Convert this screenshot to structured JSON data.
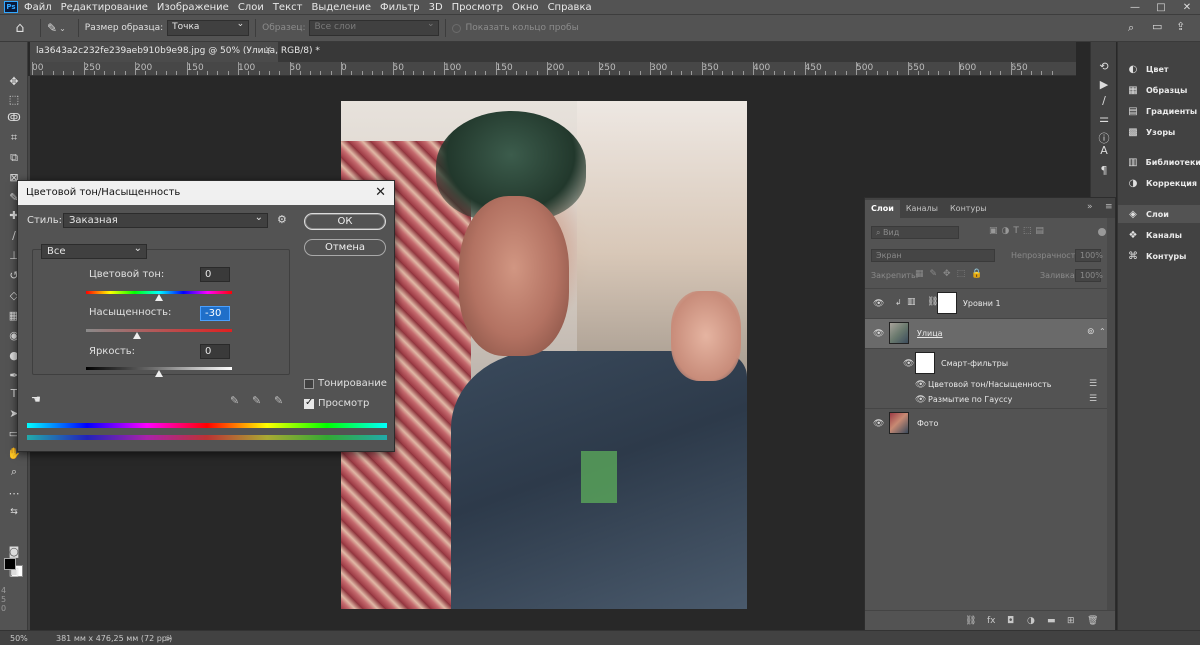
{
  "menu": [
    "Файл",
    "Редактирование",
    "Изображение",
    "Слои",
    "Текст",
    "Выделение",
    "Фильтр",
    "3D",
    "Просмотр",
    "Окно",
    "Справка"
  ],
  "app_logo": "Ps",
  "window_controls": [
    "—",
    "□",
    "✕"
  ],
  "options_bar": {
    "sample_size_label": "Размер образца:",
    "sample_size_value": "Точка",
    "sample_label": "Образец:",
    "sample_value": "Все слои",
    "show_ring_label": "Показать кольцо пробы"
  },
  "document_tab": {
    "title": "la3643a2c232fe239aeb910b9e98.jpg @ 50% (Улица, RGB/8) *",
    "close": "×"
  },
  "ruler_labels": [
    "00",
    "250",
    "200",
    "150",
    "100",
    "50",
    "0",
    "50",
    "100",
    "150",
    "200",
    "250",
    "300",
    "350",
    "400",
    "450",
    "500",
    "550",
    "600",
    "650"
  ],
  "vruler_labels": [
    "4",
    "5",
    "0"
  ],
  "dialog": {
    "title": "Цветовой тон/Насыщенность",
    "close": "✕",
    "style_label": "Стиль:",
    "style_value": "Заказная",
    "channel_value": "Все",
    "ok_label": "ОК",
    "cancel_label": "Отмена",
    "hue_label": "Цветовой тон:",
    "hue_value": "0",
    "saturation_label": "Насыщенность:",
    "saturation_value": "-30",
    "lightness_label": "Яркость:",
    "lightness_value": "0",
    "colorize_label": "Тонирование",
    "colorize_checked": false,
    "preview_label": "Просмотр",
    "preview_checked": true
  },
  "right_panels": [
    {
      "label": "Цвет",
      "icon": "color-wheel-icon"
    },
    {
      "label": "Образцы",
      "icon": "swatches-icon"
    },
    {
      "label": "Градиенты",
      "icon": "gradient-icon"
    },
    {
      "label": "Узоры",
      "icon": "patterns-icon"
    },
    {
      "label": "Библиотеки",
      "icon": "libraries-icon"
    },
    {
      "label": "Коррекция",
      "icon": "adjustments-icon"
    },
    {
      "label": "Слои",
      "icon": "layers-icon"
    },
    {
      "label": "Каналы",
      "icon": "channels-icon"
    },
    {
      "label": "Контуры",
      "icon": "paths-icon"
    }
  ],
  "layers_panel": {
    "tabs": [
      "Слои",
      "Каналы",
      "Контуры"
    ],
    "filter_label": "Вид",
    "blend_mode": "Экран",
    "opacity_label": "Непрозрачность:",
    "opacity_value": "100%",
    "lock_label": "Закрепить:",
    "fill_label": "Заливка:",
    "fill_value": "100%",
    "layers": [
      {
        "name": "Уровни 1"
      },
      {
        "name": "Улица"
      },
      {
        "name": "Смарт-фильтры"
      },
      {
        "name": "Цветовой тон/Насыщенность"
      },
      {
        "name": "Размытие по Гауссу"
      },
      {
        "name": "Фото"
      }
    ]
  },
  "status": {
    "zoom": "50%",
    "doc_size": "381 мм x 476,25 мм (72 ppi)",
    "arrow": ">"
  }
}
